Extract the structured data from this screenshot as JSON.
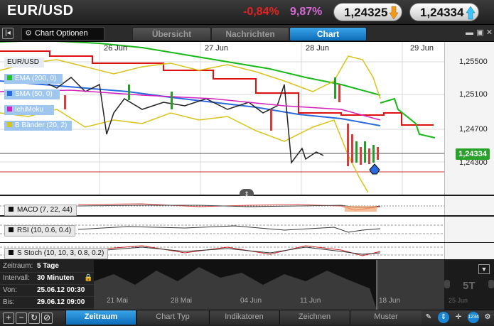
{
  "header": {
    "pair": "EUR/USD",
    "change": "-0,84%",
    "change_pct": "9,87%",
    "bid": "1,24325",
    "ask": "1,24334",
    "colors": {
      "negative": "#e52222",
      "pct": "#d46ad4",
      "bid_arrow": "#f39a1a",
      "ask_arrow": "#3ac4ff"
    }
  },
  "tabbar": {
    "chart_options": "Chart Optionen",
    "tabs": [
      "Übersicht",
      "Nachrichten",
      "Chart"
    ],
    "active_tab": "Chart",
    "accent": "#1a87d6"
  },
  "chart": {
    "x_labels": [
      "26 Jun",
      "27 Jun",
      "28 Jun",
      "29 Jun"
    ],
    "y_labels": [
      "1,25500",
      "1,25100",
      "1,24700",
      "1,24300"
    ],
    "current_price": "1,24334",
    "legend": [
      {
        "label": "EUR/USD",
        "color": "#dddddd"
      },
      {
        "label": "EMA (200, 0)",
        "color": "#1fc41f"
      },
      {
        "label": "SMA (50, 0)",
        "color": "#2a6ae0"
      },
      {
        "label": "IchiMoku",
        "color": "#d41fbe"
      },
      {
        "label": "B Bänder (20, 2)",
        "color": "#d8c31a"
      }
    ]
  },
  "indicators": [
    {
      "label": "MACD (7, 22, 44)"
    },
    {
      "label": "RSI (10, 0.6, 0.4)"
    },
    {
      "label": "S Stoch (10, 10, 3, 0.8, 0.2)"
    }
  ],
  "navigator": {
    "info": [
      {
        "key": "Zeitraum:",
        "value": "5 Tage"
      },
      {
        "key": "Intervall:",
        "value": "30 Minuten"
      },
      {
        "key": "Von:",
        "value": "25.06.12 00:30"
      },
      {
        "key": "Bis:",
        "value": "29.06.12 09:00"
      }
    ],
    "x_labels": [
      "21 Mai",
      "28 Mai",
      "04 Jun",
      "11 Jun",
      "18 Jun"
    ],
    "range_label": "5T",
    "range_label_small": "25 Jun"
  },
  "toolbar": {
    "tabs": [
      "Zeitraum",
      "Chart Typ",
      "Indikatoren",
      "Zeichnen",
      "Muster"
    ],
    "active_tab": "Zeitraum",
    "badge": "1234"
  }
}
